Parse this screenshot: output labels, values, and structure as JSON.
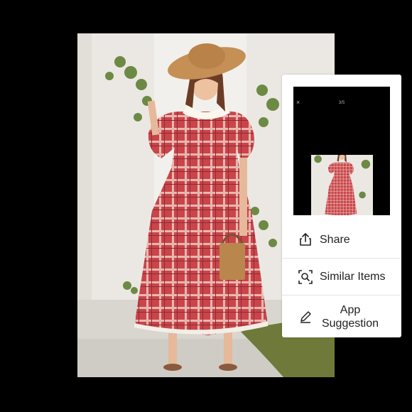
{
  "sheet": {
    "preview": {
      "close_glyph": "×",
      "counter": "3/5"
    },
    "items": [
      {
        "label": "Share",
        "icon": "share-icon"
      },
      {
        "label": "Similar Items",
        "icon": "image-search-icon"
      },
      {
        "label": "App\nSuggestion",
        "icon": "pencil-icon"
      }
    ]
  },
  "colors": {
    "background": "#000000",
    "sheet": "#ffffff",
    "dress": "#c9454a",
    "text": "#222222"
  }
}
